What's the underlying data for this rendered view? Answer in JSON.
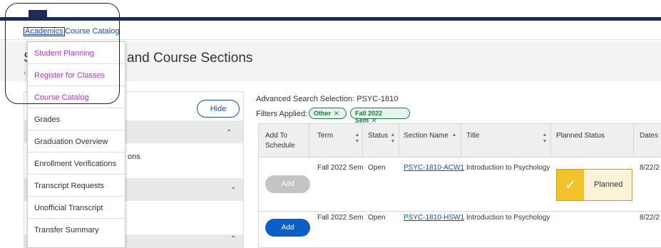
{
  "breadcrumb": {
    "academics": "Academics",
    "separator": "·",
    "course_catalog": "Course Catalog"
  },
  "page": {
    "title_first_letter": "S",
    "title_visible": "and Course Sections",
    "back_glyph": "‹"
  },
  "menu": {
    "items": [
      {
        "label": "Student Planning",
        "highlighted": true
      },
      {
        "label": "Register for Classes",
        "highlighted": true
      },
      {
        "label": "Course Catalog",
        "highlighted": true
      },
      {
        "label": "Grades",
        "highlighted": false
      },
      {
        "label": "Graduation Overview",
        "highlighted": false
      },
      {
        "label": "Enrollment Verifications",
        "highlighted": false
      },
      {
        "label": "Transcript Requests",
        "highlighted": false
      },
      {
        "label": "Unofficial Transcript",
        "highlighted": false
      },
      {
        "label": "Transfer Summary",
        "highlighted": false
      }
    ]
  },
  "filters_panel": {
    "hide_label": "Hide",
    "partial_text": "ons",
    "chevron": "⌃"
  },
  "results": {
    "advanced_search": "Advanced Search Selection: PSYC-1810",
    "filters_applied": "Filters Applied:",
    "chips": [
      {
        "label": "Other",
        "close": "✕"
      },
      {
        "label": "Fall 2022 Sem",
        "close": "✕"
      }
    ],
    "columns": {
      "add": "Add To Schedule",
      "term": "Term",
      "status": "Status",
      "section": "Section Name",
      "title": "Title",
      "planned": "Planned Status",
      "dates": "Dates"
    },
    "rows": [
      {
        "add_label": "Add",
        "term": "Fall 2022 Sem",
        "status": "Open",
        "section": "PSYC-1810-ACW1",
        "title": "Introduction to Psychology",
        "planned": "Planned",
        "dates": "8/22/2"
      },
      {
        "add_label": "Add",
        "term": "Fall 2022 Sem",
        "status": "Open",
        "section": "PSYC-1810-HSW1",
        "title": "Introduction to Psychology",
        "planned": "",
        "dates": "8/22/2"
      }
    ]
  },
  "colors": {
    "brand_navy": "#1e2a5a",
    "link_blue": "#1a4fa3",
    "menu_highlight": "#b535d1",
    "chip_green": "#1a7a3c",
    "planned_yellow": "#f2c22a",
    "add_button_blue": "#0d5fc7"
  }
}
